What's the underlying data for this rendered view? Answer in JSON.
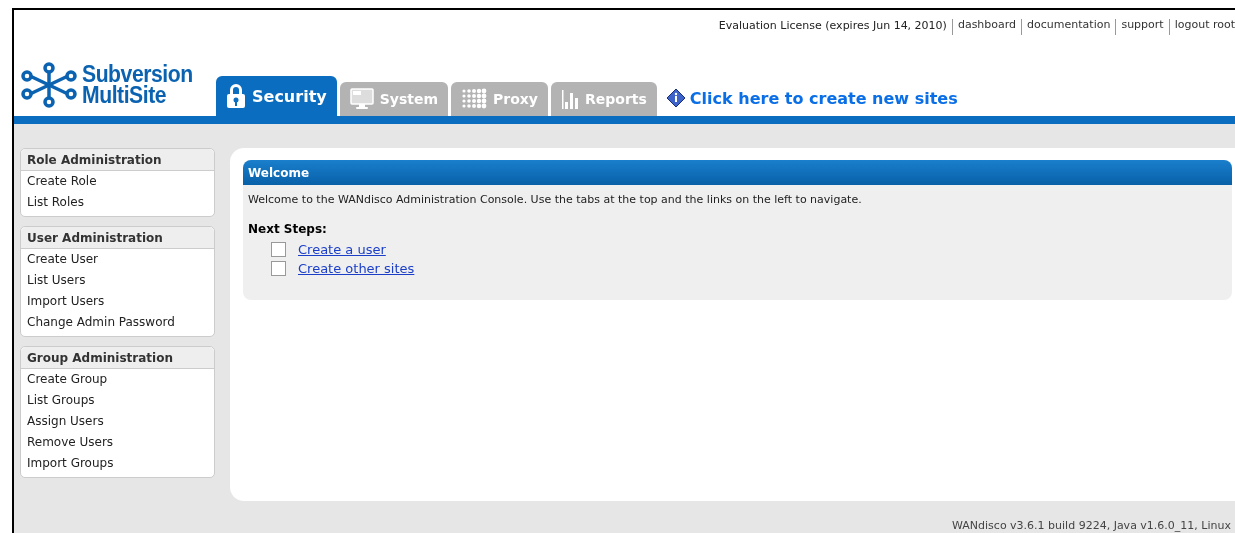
{
  "top_links": {
    "license": "Evaluation License (expires Jun 14, 2010)",
    "links": [
      "dashboard",
      "documentation",
      "support",
      "logout root"
    ]
  },
  "logo": {
    "line1": "Subversion",
    "line2": "MultiSite"
  },
  "tabs": [
    {
      "label": "Security",
      "selected": true
    },
    {
      "label": "System",
      "selected": false
    },
    {
      "label": "Proxy",
      "selected": false
    },
    {
      "label": "Reports",
      "selected": false
    }
  ],
  "create_sites_link": "Click here to create new sites",
  "sidebar": [
    {
      "title": "Role Administration",
      "items": [
        "Create Role",
        "List Roles"
      ]
    },
    {
      "title": "User Administration",
      "items": [
        "Create User",
        "List Users",
        "Import Users",
        "Change Admin Password"
      ]
    },
    {
      "title": "Group Administration",
      "items": [
        "Create Group",
        "List Groups",
        "Assign Users",
        "Remove Users",
        "Import Groups"
      ]
    }
  ],
  "welcome": {
    "title": "Welcome",
    "text": "Welcome to the WANdisco Administration Console. Use the tabs at the top and the links on the left to navigate.",
    "next_steps_label": "Next Steps:",
    "steps": [
      {
        "label": "Create a user",
        "checked": false
      },
      {
        "label": "Create other sites",
        "checked": false
      }
    ]
  },
  "footer": "WANdisco v3.6.1 build 9224, Java v1.6.0_11, Linux"
}
